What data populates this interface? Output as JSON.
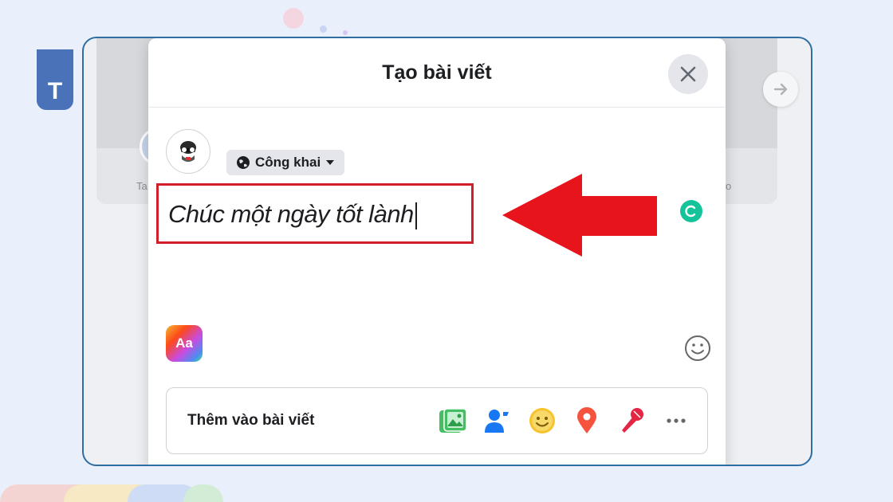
{
  "badge": {
    "letter": "T"
  },
  "dialog": {
    "title": "Tạo bài viết",
    "privacy_label": "Công khai",
    "post_text": "Chúc một ngày tốt lành",
    "format_label": "Aa",
    "add_to_post_label": "Thêm vào bài viết",
    "add_icons": [
      "photo-icon",
      "tag-people-icon",
      "feeling-icon",
      "location-icon",
      "live-mic-icon",
      "more-icon"
    ]
  },
  "background": {
    "left_caption": "Ta",
    "right_caption": "o"
  },
  "colors": {
    "highlight_border": "#d11e2a",
    "arrow": "#e8141c",
    "frame_border": "#2f6ea3",
    "badge": "#4a72b8"
  }
}
